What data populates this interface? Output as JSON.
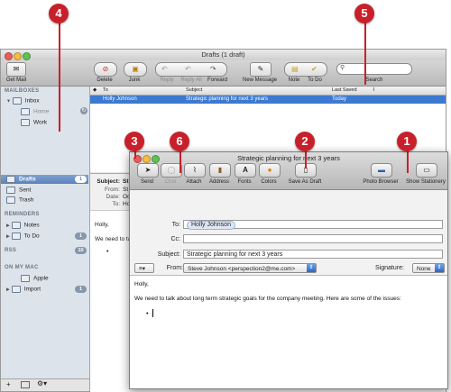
{
  "callouts": [
    "4",
    "5",
    "3",
    "6",
    "2",
    "1"
  ],
  "main": {
    "title": "Drafts (1 draft)",
    "toolbar": {
      "get_mail": "Get Mail",
      "delete": "Delete",
      "junk": "Junk",
      "reply": "Reply",
      "reply_all": "Reply All",
      "forward": "Forward",
      "new_message": "New Message",
      "note": "Note",
      "to_do": "To Do",
      "search": "Search"
    },
    "sidebar": {
      "mailboxes_header": "MAILBOXES",
      "inbox": "Inbox",
      "home": "Home",
      "work": "Work",
      "drafts": "Drafts",
      "drafts_count": "1",
      "sent": "Sent",
      "trash": "Trash",
      "reminders_header": "REMINDERS",
      "notes": "Notes",
      "to_do": "To Do",
      "to_do_count": "1",
      "rss_header": "RSS",
      "rss_count": "10",
      "on_my_mac_header": "ON MY MAC",
      "apple": "Apple",
      "import": "Import",
      "import_count": "1"
    },
    "list": {
      "col_to": "To",
      "col_subject": "Subject",
      "col_last_saved": "Last Saved",
      "row_to": "Holly Johnson",
      "row_subject": "Strategic planning for next 3 years",
      "row_saved": "Today"
    },
    "preview": {
      "subject_label": "Subject:",
      "subject_value": "St",
      "from_label": "From:",
      "from_value": "St",
      "date_label": "Date:",
      "date_value": "Oc",
      "to_label": "To:",
      "to_value": "Ho",
      "greeting": "Holly,",
      "line1": "We need to ta"
    }
  },
  "compose": {
    "title": "Strategic planning for next 3 years",
    "toolbar": {
      "send": "Send",
      "chat": "Chat",
      "attach": "Attach",
      "address": "Address",
      "fonts": "Fonts",
      "colors": "Colors",
      "save_as_draft": "Save As Draft",
      "photo_browser": "Photo Browser",
      "show_stationery": "Show Stationery"
    },
    "fields": {
      "to_label": "To:",
      "to_value": "Holly Johnson",
      "cc_label": "Cc:",
      "cc_value": "",
      "subject_label": "Subject:",
      "subject_value": "Strategic planning for next 3 years",
      "from_label": "From:",
      "from_value": "Steve Johnson <perspection2@me.com>",
      "signature_label": "Signature:",
      "signature_value": "None"
    },
    "body": {
      "greeting": "Holly,",
      "line1": "We need to talk about long term strategic goals for the company meeting. Here are some of the issues:",
      "bullet": "•"
    }
  }
}
